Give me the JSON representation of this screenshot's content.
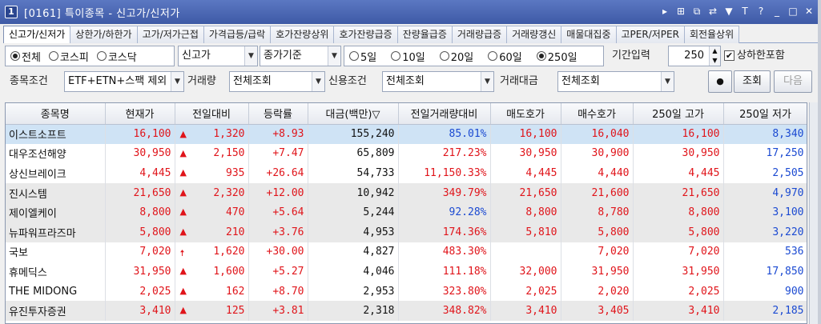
{
  "window": {
    "number": "1",
    "title": "[0161] 특이종목 - 신고가/신저가",
    "controls": [
      "▸",
      "⊞",
      "⧉",
      "⇄",
      "▼",
      "T",
      "?",
      "_",
      "□",
      "✕"
    ]
  },
  "tabs": [
    {
      "label": "신고가/신저가",
      "active": true
    },
    {
      "label": "상한가/하한가"
    },
    {
      "label": "고가/저가근접"
    },
    {
      "label": "가격급등/급락"
    },
    {
      "label": "호가잔량상위"
    },
    {
      "label": "호가잔량급증"
    },
    {
      "label": "잔량율급증"
    },
    {
      "label": "거래량급증"
    },
    {
      "label": "거래량갱신"
    },
    {
      "label": "매물대집중"
    },
    {
      "label": "고PER/저PER"
    },
    {
      "label": "회전율상위"
    }
  ],
  "market_radios": [
    {
      "label": "전체",
      "selected": true
    },
    {
      "label": "코스피",
      "selected": false
    },
    {
      "label": "코스닥",
      "selected": false
    }
  ],
  "type_select": "신고가",
  "basis_select": "종가기준",
  "period_radios": [
    {
      "label": "5일",
      "selected": false
    },
    {
      "label": "10일",
      "selected": false
    },
    {
      "label": "20일",
      "selected": false
    },
    {
      "label": "60일",
      "selected": false
    },
    {
      "label": "250일",
      "selected": true
    }
  ],
  "period_input": {
    "label": "기간입력",
    "value": "250"
  },
  "limit_checkbox": {
    "label": "상하한포함",
    "checked": true
  },
  "row2": {
    "cond_label": "종목조건",
    "cond_value": "ETF+ETN+스팩 제외",
    "volume_label": "거래량",
    "volume_value": "전체조회",
    "credit_label": "신용조건",
    "credit_value": "전체조회",
    "amount_label": "거래대금",
    "amount_value": "전체조회",
    "search_button": "조회",
    "next_button": "다음"
  },
  "columns": [
    "종목명",
    "현재가",
    "전일대비",
    "등락률",
    "대금(백만)▽",
    "전일거래량대비",
    "매도호가",
    "매수호가",
    "250일 고가",
    "250일 저가"
  ],
  "rows": [
    {
      "name": "이스트소프트",
      "price": "16,100",
      "arrow": "▲",
      "change": "1,320",
      "rate": "+8.93",
      "amount": "155,240",
      "vol_ratio": "85.01%",
      "vol_color": "blue",
      "ask": "16,100",
      "bid": "16,040",
      "high": "16,100",
      "low": "8,340"
    },
    {
      "name": "대우조선해양",
      "price": "30,950",
      "arrow": "▲",
      "change": "2,150",
      "rate": "+7.47",
      "amount": "65,809",
      "vol_ratio": "217.23%",
      "vol_color": "red",
      "ask": "30,950",
      "bid": "30,900",
      "high": "30,950",
      "low": "17,250"
    },
    {
      "name": "상신브레이크",
      "price": "4,445",
      "arrow": "▲",
      "change": "935",
      "rate": "+26.64",
      "amount": "54,733",
      "vol_ratio": "11,150.33%",
      "vol_color": "red",
      "ask": "4,445",
      "bid": "4,440",
      "high": "4,445",
      "low": "2,505"
    },
    {
      "name": "진시스템",
      "price": "21,650",
      "arrow": "▲",
      "change": "2,320",
      "rate": "+12.00",
      "amount": "10,942",
      "vol_ratio": "349.79%",
      "vol_color": "red",
      "ask": "21,650",
      "bid": "21,600",
      "high": "21,650",
      "low": "4,970"
    },
    {
      "name": "제이엘케이",
      "price": "8,800",
      "arrow": "▲",
      "change": "470",
      "rate": "+5.64",
      "amount": "5,244",
      "vol_ratio": "92.28%",
      "vol_color": "blue",
      "ask": "8,800",
      "bid": "8,780",
      "high": "8,800",
      "low": "3,100"
    },
    {
      "name": "뉴파워프라즈마",
      "price": "5,800",
      "arrow": "▲",
      "change": "210",
      "rate": "+3.76",
      "amount": "4,953",
      "vol_ratio": "174.36%",
      "vol_color": "red",
      "ask": "5,810",
      "bid": "5,800",
      "high": "5,800",
      "low": "3,220"
    },
    {
      "name": "국보",
      "price": "7,020",
      "arrow": "🠅",
      "change": "1,620",
      "rate": "+30.00",
      "amount": "4,827",
      "vol_ratio": "483.30%",
      "vol_color": "red",
      "ask": "",
      "bid": "7,020",
      "high": "7,020",
      "low": "536"
    },
    {
      "name": "휴메딕스",
      "price": "31,950",
      "arrow": "▲",
      "change": "1,600",
      "rate": "+5.27",
      "amount": "4,046",
      "vol_ratio": "111.18%",
      "vol_color": "red",
      "ask": "32,000",
      "bid": "31,950",
      "high": "31,950",
      "low": "17,850"
    },
    {
      "name": "THE MIDONG",
      "price": "2,025",
      "arrow": "▲",
      "change": "162",
      "rate": "+8.70",
      "amount": "2,953",
      "vol_ratio": "323.80%",
      "vol_color": "red",
      "ask": "2,025",
      "bid": "2,020",
      "high": "2,025",
      "low": "900"
    },
    {
      "name": "유진투자증권",
      "price": "3,410",
      "arrow": "▲",
      "change": "125",
      "rate": "+3.81",
      "amount": "2,318",
      "vol_ratio": "348.82%",
      "vol_color": "red",
      "ask": "3,410",
      "bid": "3,405",
      "high": "3,410",
      "low": "2,185"
    }
  ],
  "colors": {
    "up": "#e0141a",
    "down": "#1b4ad2",
    "selected_row": "#cfe3f5",
    "title_bar": "#4a66b3"
  }
}
